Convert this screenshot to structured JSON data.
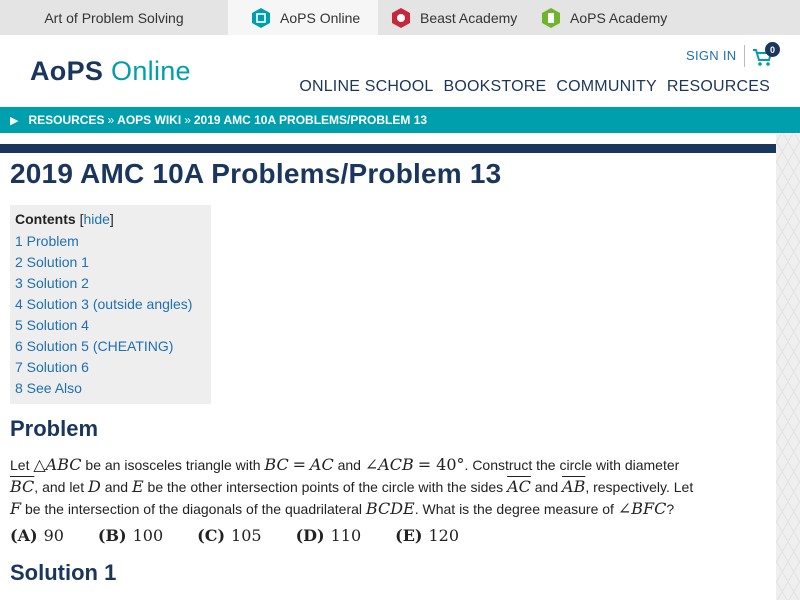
{
  "sitebar": {
    "sites": [
      {
        "label": "Art of Problem Solving",
        "icon": "none"
      },
      {
        "label": "AoPS Online",
        "icon": "aops-online-icon"
      },
      {
        "label": "Beast Academy",
        "icon": "beast-academy-icon"
      },
      {
        "label": "AoPS Academy",
        "icon": "aops-academy-icon"
      }
    ]
  },
  "header": {
    "logo_a": "AoPS",
    "logo_b": "Online",
    "sign_in": "SIGN IN",
    "cart_count": "0",
    "nav": [
      "ONLINE SCHOOL",
      "BOOKSTORE",
      "COMMUNITY",
      "RESOURCES"
    ]
  },
  "breadcrumb": [
    "RESOURCES",
    "AOPS WIKI",
    "2019 AMC 10A PROBLEMS/PROBLEM 13"
  ],
  "page": {
    "title": "2019 AMC 10A Problems/Problem 13",
    "toc": {
      "title": "Contents",
      "hide": "hide",
      "items": [
        "1 Problem",
        "2 Solution 1",
        "3 Solution 2",
        "4 Solution 3 (outside angles)",
        "5 Solution 4",
        "6 Solution 5 (CHEATING)",
        "7 Solution 6",
        "8 See Also"
      ]
    },
    "problem_heading": "Problem",
    "solution_heading": "Solution 1",
    "choices": [
      {
        "label": "(A)",
        "value": "90"
      },
      {
        "label": "(B)",
        "value": "100"
      },
      {
        "label": "(C)",
        "value": "105"
      },
      {
        "label": "(D)",
        "value": "110"
      },
      {
        "label": "(E)",
        "value": "120"
      }
    ]
  },
  "colors": {
    "navy": "#1b365d",
    "teal": "#009fad",
    "link": "#1f6fb2",
    "toc_bg": "#eeeeee"
  }
}
